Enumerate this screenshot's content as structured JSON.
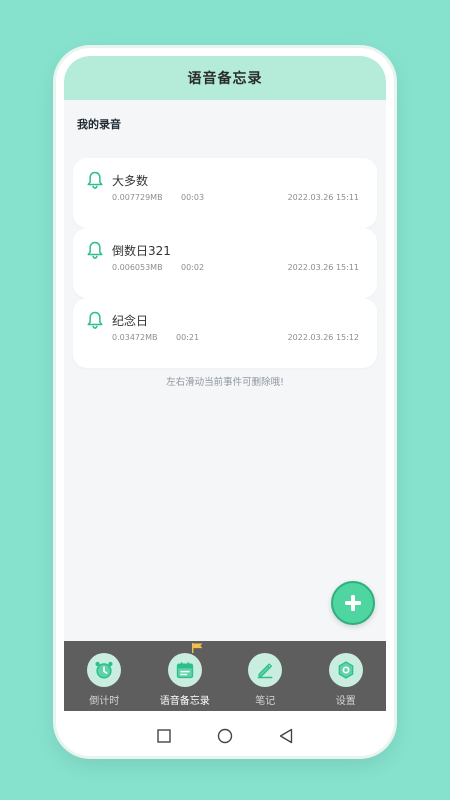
{
  "header": {
    "title": "语音备忘录"
  },
  "section": {
    "title": "我的录音"
  },
  "recordings": [
    {
      "name": "大多数",
      "size": "0.007729MB",
      "duration": "00:03",
      "date": "2022.03.26  15:11"
    },
    {
      "name": "倒数日321",
      "size": "0.006053MB",
      "duration": "00:02",
      "date": "2022.03.26  15:11"
    },
    {
      "name": "纪念日",
      "size": "0.03472MB",
      "duration": "00:21",
      "date": "2022.03.26  15:12"
    }
  ],
  "hint": "左右滑动当前事件可删除哦!",
  "fab": {
    "icon": "plus-icon"
  },
  "tabs": [
    {
      "label": "倒计时",
      "icon": "alarm-clock-icon",
      "active": false
    },
    {
      "label": "语音备忘录",
      "icon": "calendar-icon",
      "active": true
    },
    {
      "label": "笔记",
      "icon": "pen-icon",
      "active": false
    },
    {
      "label": "设置",
      "icon": "hexagon-settings-icon",
      "active": false
    }
  ],
  "colors": {
    "accent": "#4fd59f",
    "header_bg": "#b5ecd9",
    "page_bg": "#86e2cd",
    "tabbar_bg": "#5e5e5e",
    "icon_green": "#2bbf8a"
  }
}
